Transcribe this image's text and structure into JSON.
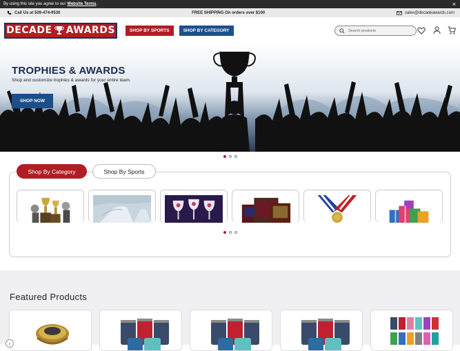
{
  "cookie": {
    "text": "By using this site you agree to our",
    "link": "Website Terms",
    "suffix": ".",
    "close": "×"
  },
  "topbar": {
    "phone": "Call Us at 509-474-9530",
    "promo": "FREE SHIPPING On orders over $100",
    "email": "sales@decadeawards.com"
  },
  "header": {
    "logo_left": "DECADE",
    "logo_right": "AWARDS",
    "nav": [
      "SHOP BY SPORTS",
      "SHOP BY CATEGORY"
    ],
    "search_placeholder": "Search products",
    "icons": [
      "heart-icon",
      "user-icon",
      "cart-icon"
    ]
  },
  "hero": {
    "title": "TROPHIES & AWARDS",
    "subtitle": "Shop and customize trophies & awards for your entire team.",
    "button": "SHOP NOW",
    "slides": 3,
    "active_slide": 1
  },
  "categories": {
    "tabs": [
      "Shop By Category",
      "Shop By Sports"
    ],
    "active_tab": 0,
    "cards": [
      {
        "icon": "trophies-image"
      },
      {
        "icon": "glass-award-image"
      },
      {
        "icon": "wine-glasses-image"
      },
      {
        "icon": "plaques-image"
      },
      {
        "icon": "medal-image"
      },
      {
        "icon": "gifts-image"
      }
    ],
    "pages": 3,
    "active_page": 1
  },
  "featured": {
    "title": "Featured Products",
    "products": [
      {
        "icon": "championship-ring-image"
      },
      {
        "icon": "tumblers-image"
      },
      {
        "icon": "tumblers-image"
      },
      {
        "icon": "tumblers-image"
      },
      {
        "icon": "tumbler-collection-image"
      }
    ],
    "prev_arrow": "‹"
  },
  "colors": {
    "brand_red": "#b01d24",
    "brand_blue": "#1b4f8a",
    "hero_navy": "#1b2a4f"
  }
}
